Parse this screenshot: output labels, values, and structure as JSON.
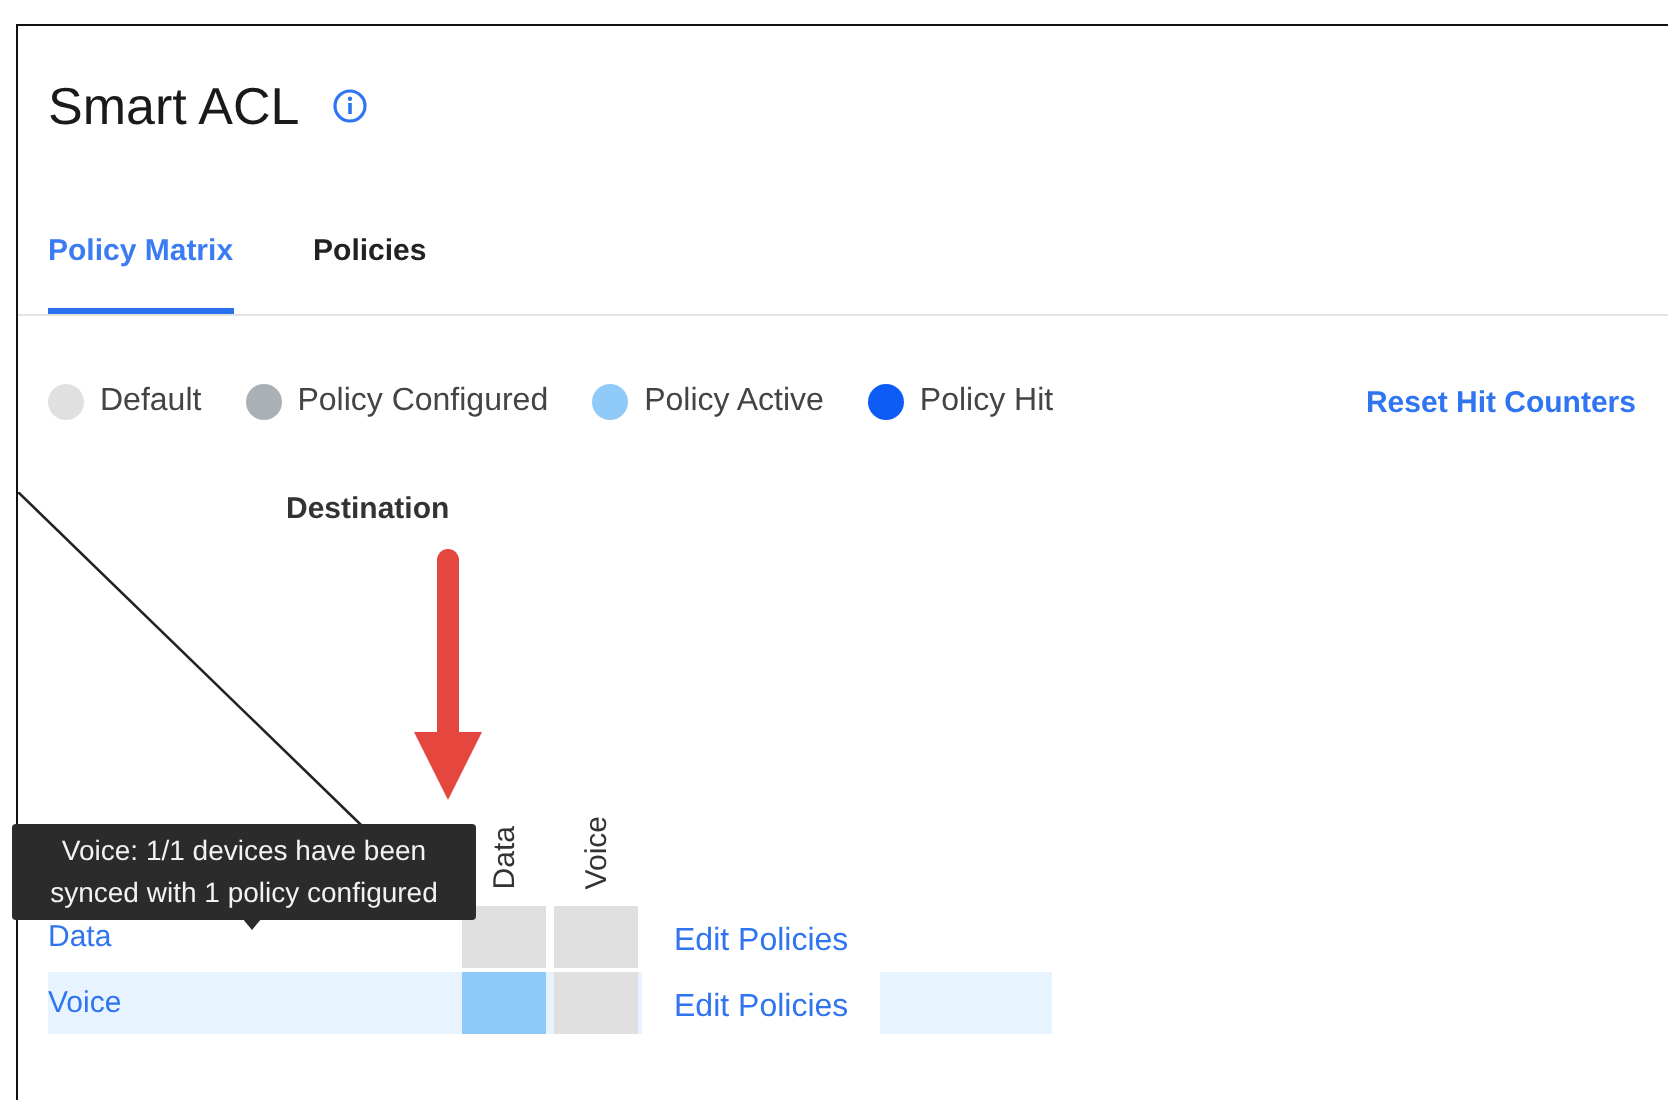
{
  "page": {
    "title": "Smart ACL"
  },
  "tabs": [
    {
      "label": "Policy Matrix",
      "selected": true
    },
    {
      "label": "Policies",
      "selected": false
    }
  ],
  "legend": [
    {
      "label": "Default",
      "color": "#e0e0e0"
    },
    {
      "label": "Policy Configured",
      "color": "#a9b0b6"
    },
    {
      "label": "Policy Active",
      "color": "#90caf9"
    },
    {
      "label": "Policy Hit",
      "color": "#0d5cf5"
    }
  ],
  "reset_link": "Reset Hit Counters",
  "matrix": {
    "destination_label": "Destination",
    "columns": [
      "Data",
      "Voice"
    ],
    "rows": [
      {
        "label": "Data",
        "selected": false,
        "cells": [
          {
            "kind": "default"
          },
          {
            "kind": "default"
          }
        ],
        "action": "Edit Policies"
      },
      {
        "label": "Voice",
        "selected": true,
        "cells": [
          {
            "kind": "active"
          },
          {
            "kind": "default"
          }
        ],
        "action": "Edit Policies"
      }
    ]
  },
  "tooltip": {
    "text": "Voice: 1/1 devices have been synced with 1 policy configured"
  }
}
